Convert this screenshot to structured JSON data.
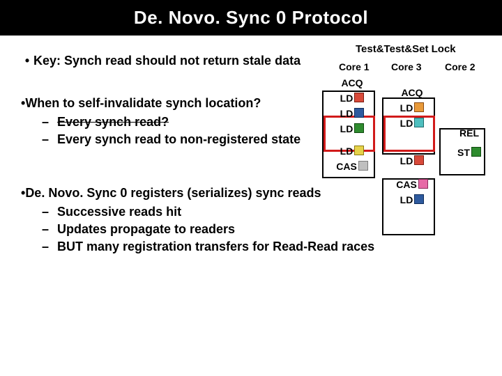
{
  "title": "De. Novo. Sync 0 Protocol",
  "annotation": "Test&Test&Set Lock",
  "headers": {
    "c1": "Core 1",
    "c3": "Core 3",
    "c2": "Core 2"
  },
  "bullets": {
    "key": "Key: Synch read should not return stale data",
    "when": "When to self-invalidate synch location?",
    "when_sub1": "Every synch read?",
    "when_sub2": "Every synch read to non-registered state",
    "reg": "De. Novo. Sync 0 registers (serializes) sync reads",
    "reg_sub1": "Successive reads hit",
    "reg_sub2": "Updates propagate to readers",
    "reg_sub3": "BUT many registration transfers for Read-Read races"
  },
  "ops": {
    "acq": "ACQ",
    "ld": "LD",
    "rel": "REL",
    "st": "ST",
    "cas": "CAS"
  }
}
